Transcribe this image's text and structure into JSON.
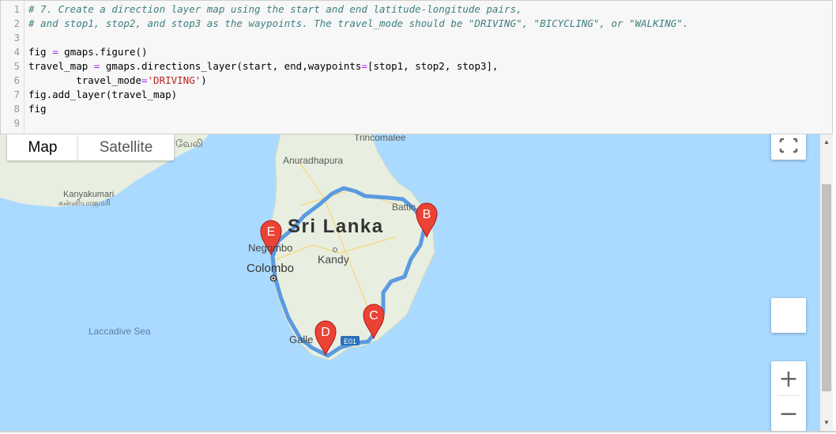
{
  "code": {
    "line_numbers": [
      "1",
      "2",
      "3",
      "4",
      "5",
      "6",
      "7",
      "8",
      "9"
    ],
    "line1_comment": "# 7. Create a direction layer map using the start and end latitude-longitude pairs,",
    "line2_comment": "# and stop1, stop2, and stop3 as the waypoints. The travel_mode should be \"DRIVING\", \"BICYCLING\", or \"WALKING\".",
    "line4_a": "fig ",
    "line4_op": "=",
    "line4_b": " gmaps.figure()",
    "line5_a": "travel_map ",
    "line5_op": "=",
    "line5_b": " gmaps.directions_layer(start, end,waypoints",
    "line5_op2": "=",
    "line5_c": "[stop1, stop2, stop3],",
    "line6_a": "        travel_mode",
    "line6_op": "=",
    "line6_str": "'DRIVING'",
    "line6_b": ")",
    "line7": "fig.add_layer(travel_map)",
    "line8": "fig"
  },
  "map": {
    "type_buttons": {
      "map": "Map",
      "satellite": "Satellite"
    },
    "labels": {
      "country": "Sri Lanka",
      "anuradhapura": "Anuradhapura",
      "trincomalee": "Trincomalee",
      "batticaloa": "Battic",
      "negombo": "Negombo",
      "kandy": "Kandy",
      "colombo": "Colombo",
      "galle": "Galle",
      "kanyakumari": "Kanyakumari",
      "kanyakumari_tamil": "கன்னியாகுமரி",
      "laccadive_sea": "Laccadive Sea",
      "partial_left": "வேலி",
      "highway": "E01"
    },
    "markers": [
      "B",
      "C",
      "D",
      "E"
    ],
    "route_color": "#4a90e2",
    "marker_color": "#ea4335",
    "water_color": "#aadaff",
    "land_color": "#e8efe0"
  },
  "controls": {
    "zoom_in": "+",
    "zoom_out": "−"
  }
}
